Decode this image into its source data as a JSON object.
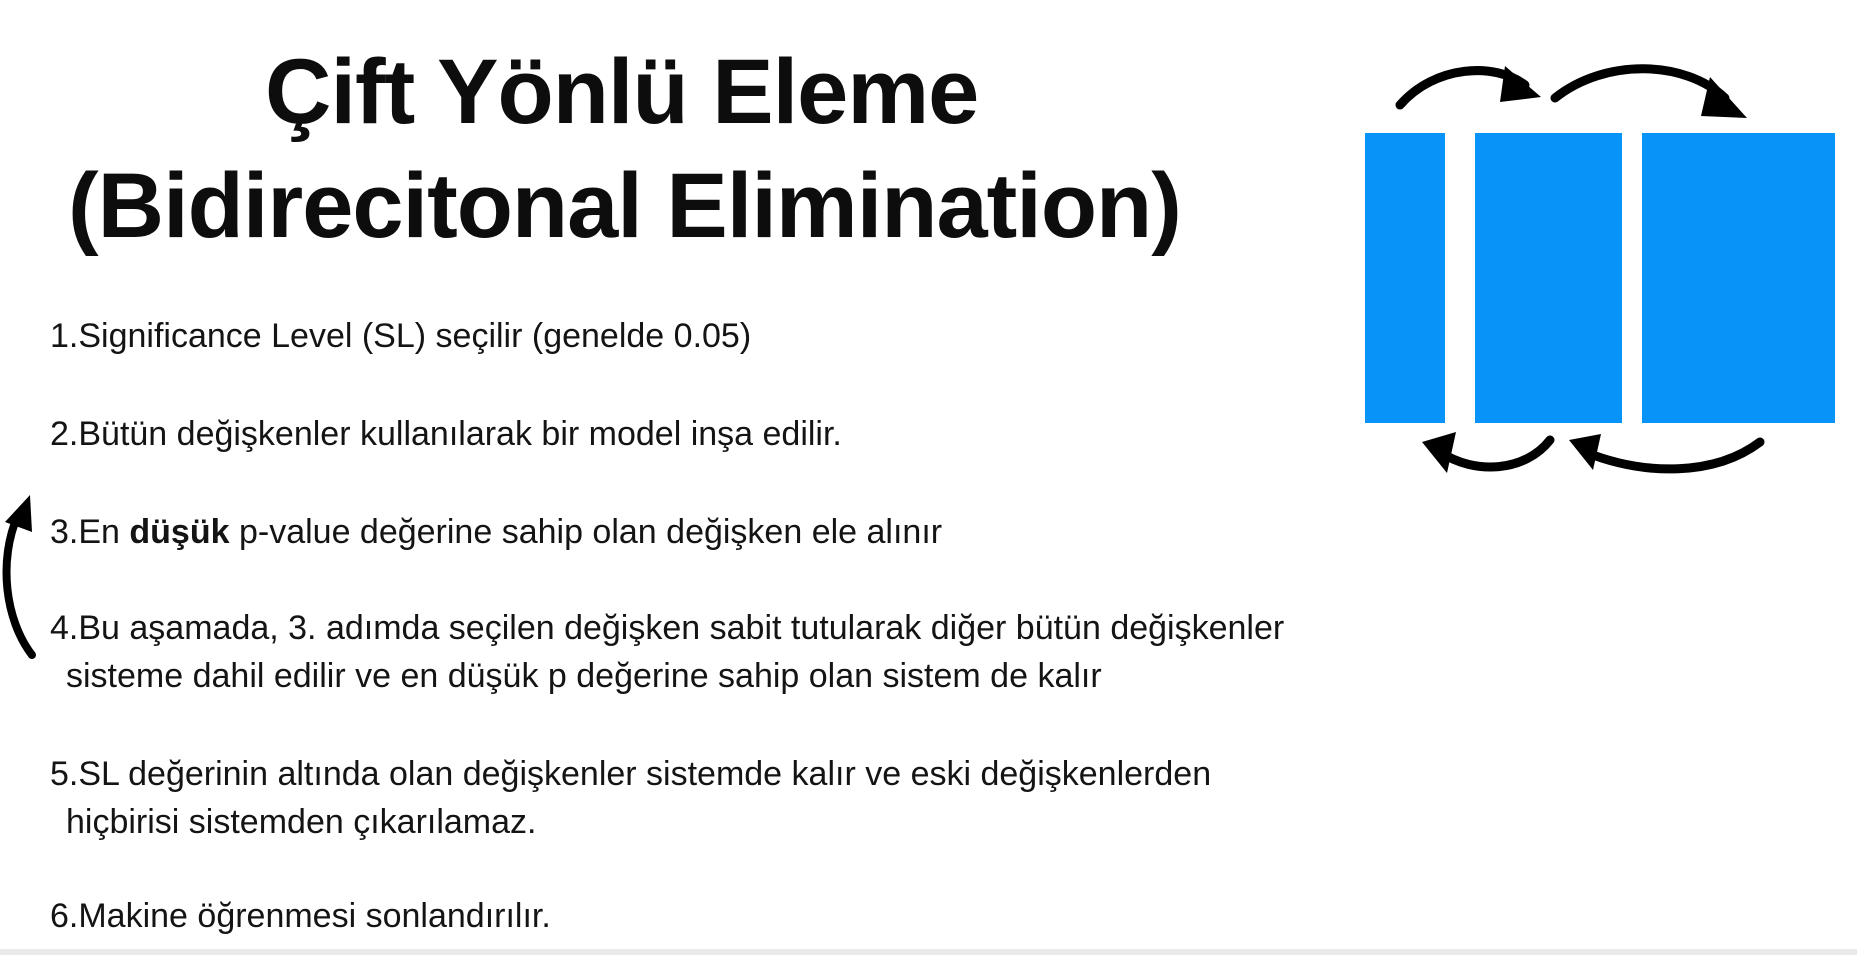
{
  "title": {
    "line1": "Çift Yönlü Eleme",
    "line2": "(Bidirecitonal Elimination)"
  },
  "steps": [
    {
      "line1": "1.Significance Level (SL) seçilir (genelde 0.05)"
    },
    {
      "line1": "2.Bütün değişkenler kullanılarak bir model inşa edilir."
    },
    {
      "prefix": "3.En ",
      "bold": "düşük",
      "suffix": " p-value değerine sahip olan değişken ele alınır"
    },
    {
      "line1": "4.Bu aşamada, 3. adımda seçilen değişken sabit tutularak diğer bütün değişkenler",
      "line2": "sisteme dahil edilir ve en düşük p değerine sahip olan sistem de kalır"
    },
    {
      "line1": "5.SL değerinin altında olan değişkenler sistemde kalır ve eski değişkenlerden",
      "line2": "hiçbirisi sistemden çıkarılamaz."
    },
    {
      "line1": "6.Makine öğrenmesi sonlandırılır."
    }
  ],
  "colors": {
    "block": "#0793f7",
    "arrow": "#000000",
    "text": "#141414"
  },
  "icons": {
    "diagram": "bidirectional-blocks-diagram",
    "loop": "loop-back-arrow-icon"
  }
}
